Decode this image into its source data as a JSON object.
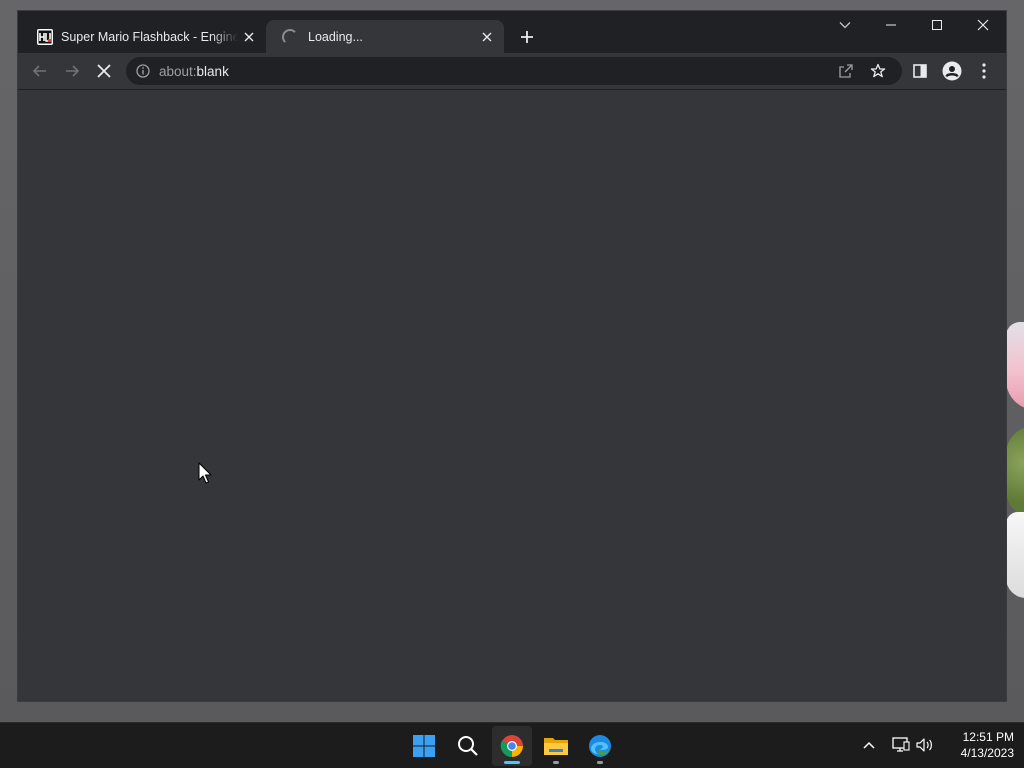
{
  "browser": {
    "tabs": [
      {
        "title": "Super Mario Flashback - Engine T",
        "favicon": "mario-game-favicon",
        "active": false
      },
      {
        "title": "Loading...",
        "favicon": "loading-spinner",
        "active": true
      }
    ],
    "address_bar": {
      "scheme": "about:",
      "host": "blank"
    },
    "colors": {
      "frame": "#202124",
      "toolbar": "#35363a",
      "content": "#35363a",
      "text": "#e8eaed"
    }
  },
  "taskbar": {
    "apps": [
      {
        "name": "start",
        "icon": "windows-start-icon"
      },
      {
        "name": "search",
        "icon": "search-icon"
      },
      {
        "name": "chrome",
        "icon": "chrome-icon",
        "active": true
      },
      {
        "name": "file-explorer",
        "icon": "folder-icon"
      },
      {
        "name": "edge",
        "icon": "edge-icon"
      }
    ],
    "tray_icons": [
      "chevron-up-icon",
      "network-icon",
      "volume-icon"
    ],
    "clock": {
      "time": "12:51 PM",
      "date": "4/13/2023"
    }
  }
}
